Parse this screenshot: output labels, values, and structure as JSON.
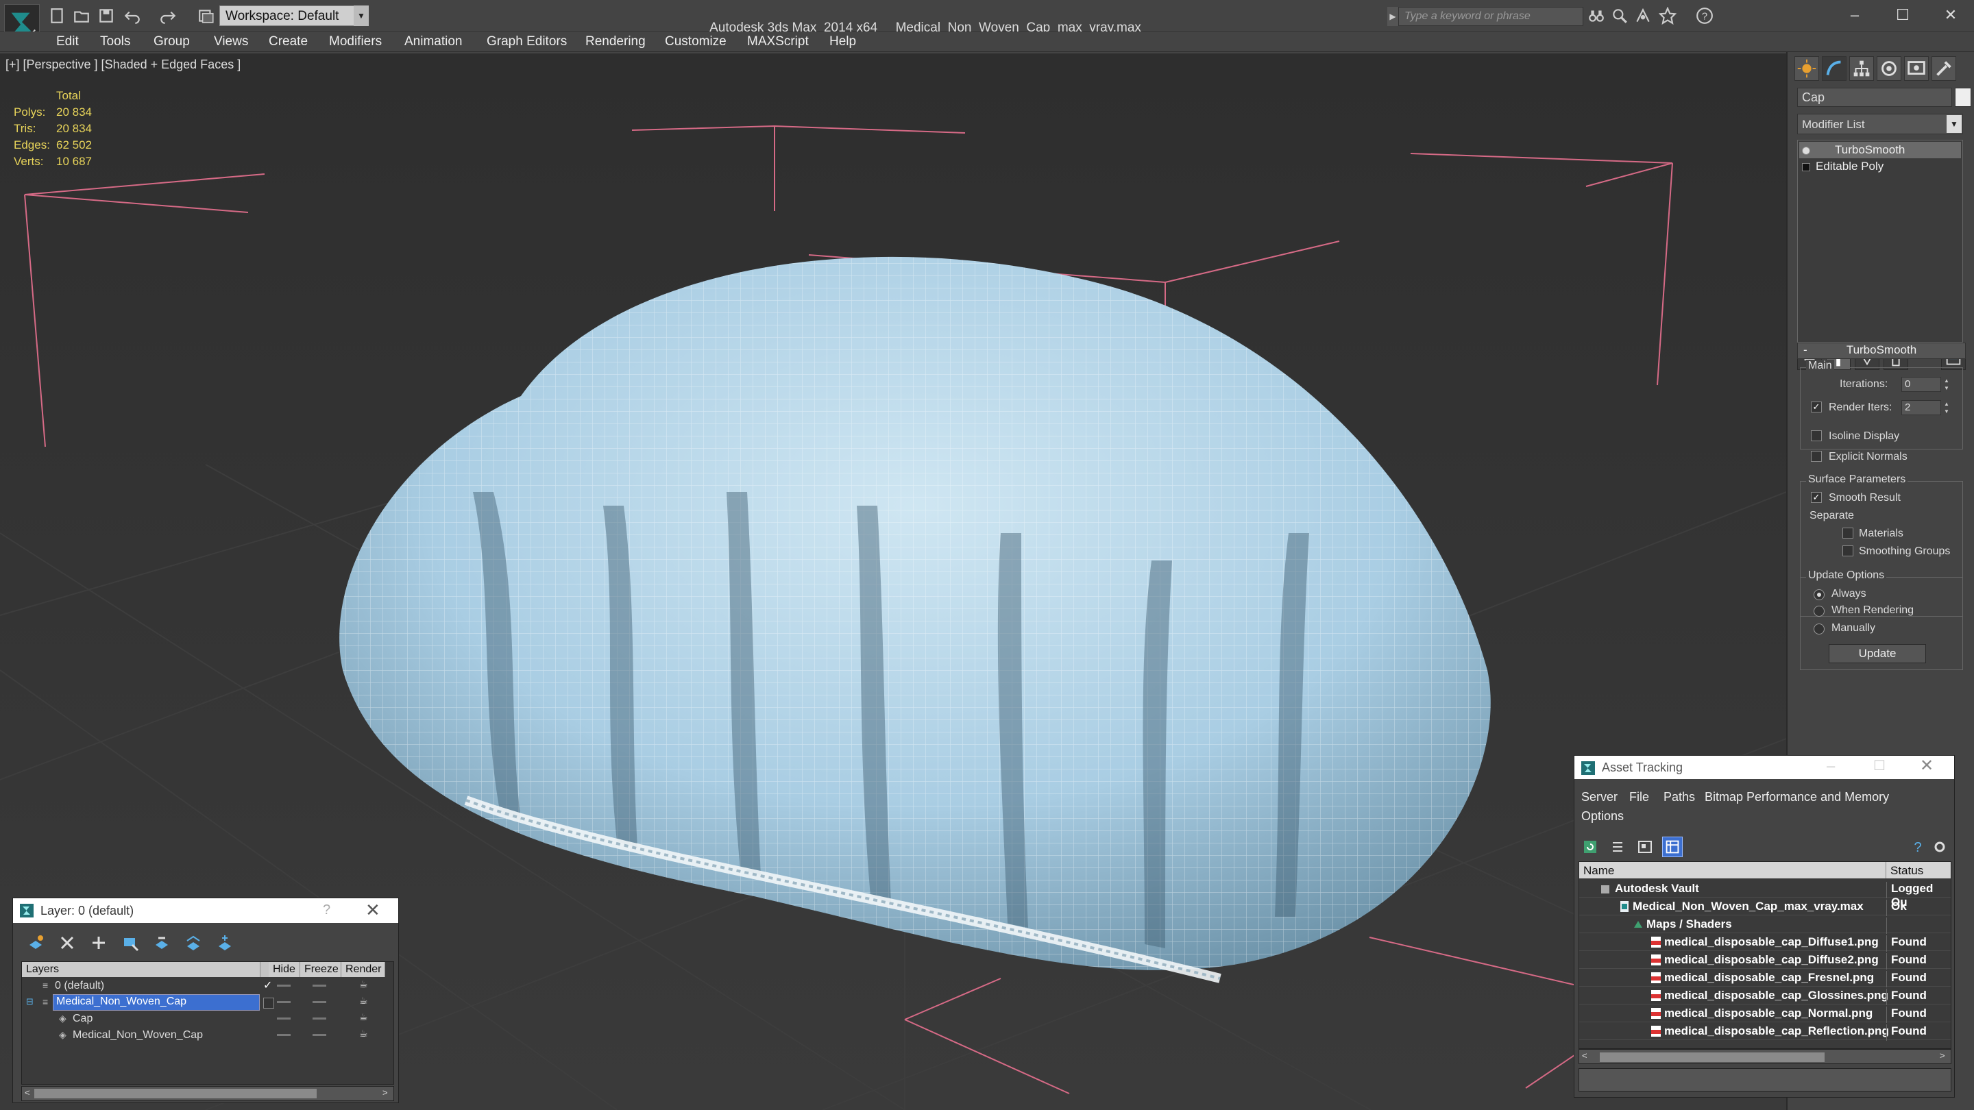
{
  "title_bar": {
    "workspace_label": "Workspace: Default",
    "app_name": "Autodesk 3ds Max  2014 x64",
    "file_name": "Medical_Non_Woven_Cap_max_vray.max",
    "search_placeholder": "Type a keyword or phrase"
  },
  "menu": {
    "items": [
      "Edit",
      "Tools",
      "Group",
      "Views",
      "Create",
      "Modifiers",
      "Animation",
      "Graph Editors",
      "Rendering",
      "Customize",
      "MAXScript",
      "Help"
    ]
  },
  "viewport": {
    "label": "[+] [Perspective ] [Shaded + Edged Faces ]",
    "stats": {
      "header": "Total",
      "polys_label": "Polys:",
      "polys": "20 834",
      "tris_label": "Tris:",
      "tris": "20 834",
      "edges_label": "Edges:",
      "edges": "62 502",
      "verts_label": "Verts:",
      "verts": "10 687"
    },
    "mesh_color": "#a9cde3"
  },
  "command_panel": {
    "object_name": "Cap",
    "modifier_list_label": "Modifier List",
    "stack": [
      "TurboSmooth",
      "Editable Poly"
    ],
    "rollout_title": "TurboSmooth",
    "main_group": "Main",
    "iterations_label": "Iterations:",
    "iterations_value": "0",
    "render_iters_label": "Render Iters:",
    "render_iters_value": "2",
    "render_iters_checked": true,
    "isoline_label": "Isoline Display",
    "explicit_normals_label": "Explicit Normals",
    "surface_group": "Surface Parameters",
    "smooth_result_label": "Smooth Result",
    "separate_label": "Separate",
    "materials_label": "Materials",
    "smoothing_groups_label": "Smoothing Groups",
    "update_group": "Update Options",
    "always_label": "Always",
    "when_rendering_label": "When Rendering",
    "manually_label": "Manually",
    "update_button": "Update"
  },
  "layer_dialog": {
    "title": "Layer: 0 (default)",
    "help_glyph": "?",
    "close_glyph": "✕",
    "col_layers": "Layers",
    "col_hide": "Hide",
    "col_freeze": "Freeze",
    "col_render": "Render",
    "rows": [
      {
        "name": "0 (default)"
      },
      {
        "name": "Medical_Non_Woven_Cap"
      },
      {
        "name": "Cap"
      },
      {
        "name": "Medical_Non_Woven_Cap"
      }
    ]
  },
  "asset_dialog": {
    "title": "Asset Tracking",
    "menu": [
      "Server",
      "File",
      "Paths",
      "Bitmap Performance and Memory",
      "Options"
    ],
    "col_name": "Name",
    "col_status": "Status",
    "rows": [
      {
        "name": "Autodesk Vault",
        "status": "Logged Ou"
      },
      {
        "name": "Medical_Non_Woven_Cap_max_vray.max",
        "status": "Ok"
      },
      {
        "name": "Maps / Shaders",
        "status": ""
      },
      {
        "name": "medical_disposable_cap_Diffuse1.png",
        "status": "Found"
      },
      {
        "name": "medical_disposable_cap_Diffuse2.png",
        "status": "Found"
      },
      {
        "name": "medical_disposable_cap_Fresnel.png",
        "status": "Found"
      },
      {
        "name": "medical_disposable_cap_Glossines.png",
        "status": "Found"
      },
      {
        "name": "medical_disposable_cap_Normal.png",
        "status": "Found"
      },
      {
        "name": "medical_disposable_cap_Reflection.png",
        "status": "Found"
      }
    ]
  }
}
